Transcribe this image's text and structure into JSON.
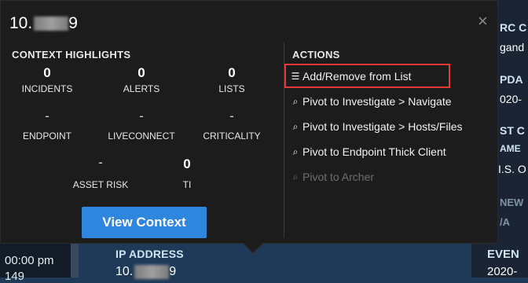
{
  "popup": {
    "title_prefix": "10.",
    "title_suffix": "9",
    "close_symbol": "×",
    "context_title": "CONTEXT HIGHLIGHTS",
    "actions_title": "ACTIONS",
    "metrics_row1": [
      {
        "value": "0",
        "label": "INCIDENTS"
      },
      {
        "value": "0",
        "label": "ALERTS"
      },
      {
        "value": "0",
        "label": "LISTS"
      }
    ],
    "metrics_row2": [
      {
        "value": "-",
        "label": "ENDPOINT"
      },
      {
        "value": "-",
        "label": "LIVECONNECT"
      },
      {
        "value": "-",
        "label": "CRITICALITY"
      }
    ],
    "metrics_row3": [
      {
        "value": "-",
        "label": "ASSET RISK"
      },
      {
        "value": "0",
        "label": "TI"
      }
    ],
    "view_context_label": "View Context",
    "actions": [
      {
        "label": "Add/Remove from List",
        "icon": "list-icon",
        "glyph": "☰",
        "enabled": true,
        "highlighted": true
      },
      {
        "label": "Pivot to Investigate > Navigate",
        "icon": "search-icon",
        "glyph": "⌕",
        "enabled": true
      },
      {
        "label": "Pivot to Investigate > Hosts/Files",
        "icon": "search-icon",
        "glyph": "⌕",
        "enabled": true
      },
      {
        "label": "Pivot to Endpoint Thick Client",
        "icon": "search-icon",
        "glyph": "⌕",
        "enabled": true
      },
      {
        "label": "Pivot to Archer",
        "icon": "search-icon",
        "glyph": "⌕",
        "enabled": false
      }
    ]
  },
  "background": {
    "left_time": "00:00 pm",
    "left_partial": "149",
    "ip_label": "IP ADDRESS",
    "ip_value_prefix": "10.",
    "ip_value_suffix": "9",
    "right_fragments": [
      {
        "text": "RC C",
        "kind": "head"
      },
      {
        "text": "gand",
        "kind": "val"
      },
      {
        "text": "PDA",
        "kind": "head"
      },
      {
        "text": "020-",
        "kind": "val"
      },
      {
        "text": "ST C",
        "kind": "head"
      },
      {
        "text": "AME",
        "kind": "head"
      },
      {
        "text": "I.S. O",
        "kind": "val"
      },
      {
        "text": "NEW",
        "kind": "dim"
      },
      {
        "text": "/A",
        "kind": "dim"
      }
    ],
    "event_label": "EVEN",
    "event_value": "2020-"
  },
  "colors": {
    "popup_bg": "#1c1c1c",
    "button_blue": "#2e86de",
    "highlight_red": "#e53935",
    "app_bg": "#1f3a58"
  }
}
